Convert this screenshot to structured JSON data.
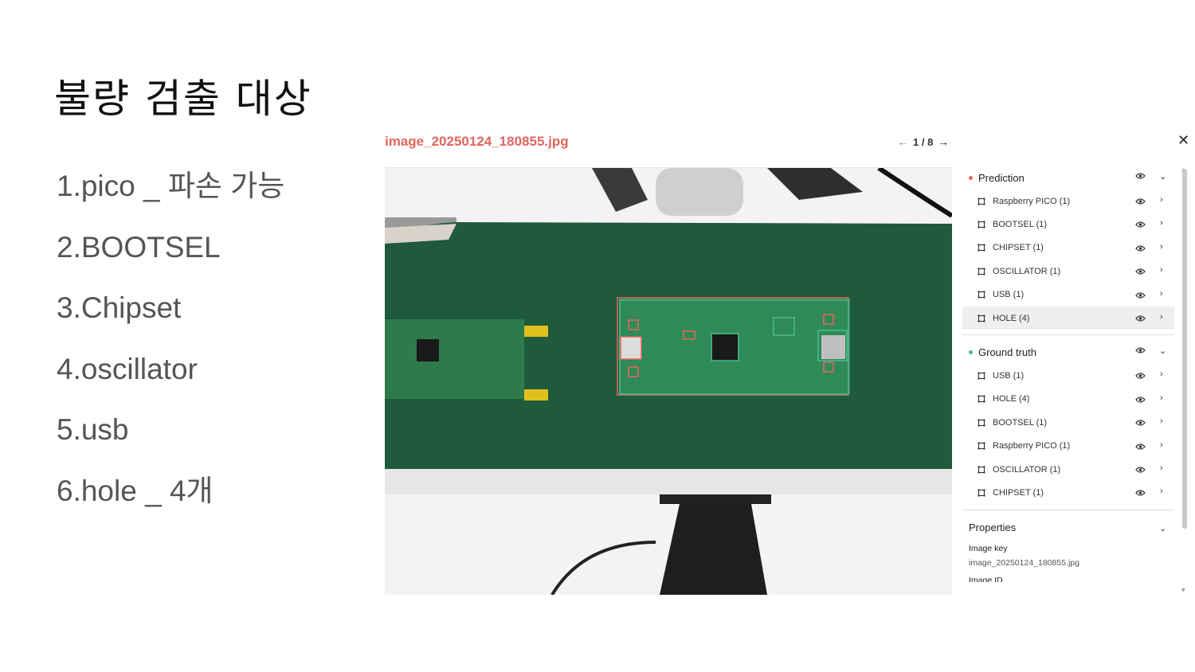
{
  "slide": {
    "title": "불량 검출 대상",
    "bullets": [
      "1.pico _ 파손 가능",
      "2.BOOTSEL",
      "3.Chipset",
      "4.oscillator",
      "5.usb",
      "6.hole _ 4개"
    ]
  },
  "viewer": {
    "file_name": "image_20250124_180855.jpg",
    "pager": {
      "current_of_total": "1 / 8",
      "prev_icon": "arrow-left-icon",
      "next_icon": "arrow-right-icon"
    },
    "close_icon": "close-icon",
    "accent_color": "#e0665e"
  },
  "panel": {
    "prediction": {
      "label": "Prediction",
      "dot_color": "#e0665e",
      "items": [
        {
          "label": "Raspberry PICO (1)",
          "selected": false
        },
        {
          "label": "BOOTSEL (1)",
          "selected": false
        },
        {
          "label": "CHIPSET (1)",
          "selected": false
        },
        {
          "label": "OSCILLATOR (1)",
          "selected": false
        },
        {
          "label": "USB (1)",
          "selected": false
        },
        {
          "label": "HOLE (4)",
          "selected": true
        }
      ]
    },
    "ground_truth": {
      "label": "Ground truth",
      "dot_color": "#46b98a",
      "items": [
        {
          "label": "USB (1)"
        },
        {
          "label": "HOLE (4)"
        },
        {
          "label": "BOOTSEL (1)"
        },
        {
          "label": "Raspberry PICO (1)"
        },
        {
          "label": "OSCILLATOR (1)"
        },
        {
          "label": "CHIPSET (1)"
        }
      ]
    },
    "properties": {
      "label": "Properties",
      "image_key_label": "Image key",
      "image_key_value": "image_20250124_180855.jpg",
      "image_id_label": "Image ID"
    }
  }
}
